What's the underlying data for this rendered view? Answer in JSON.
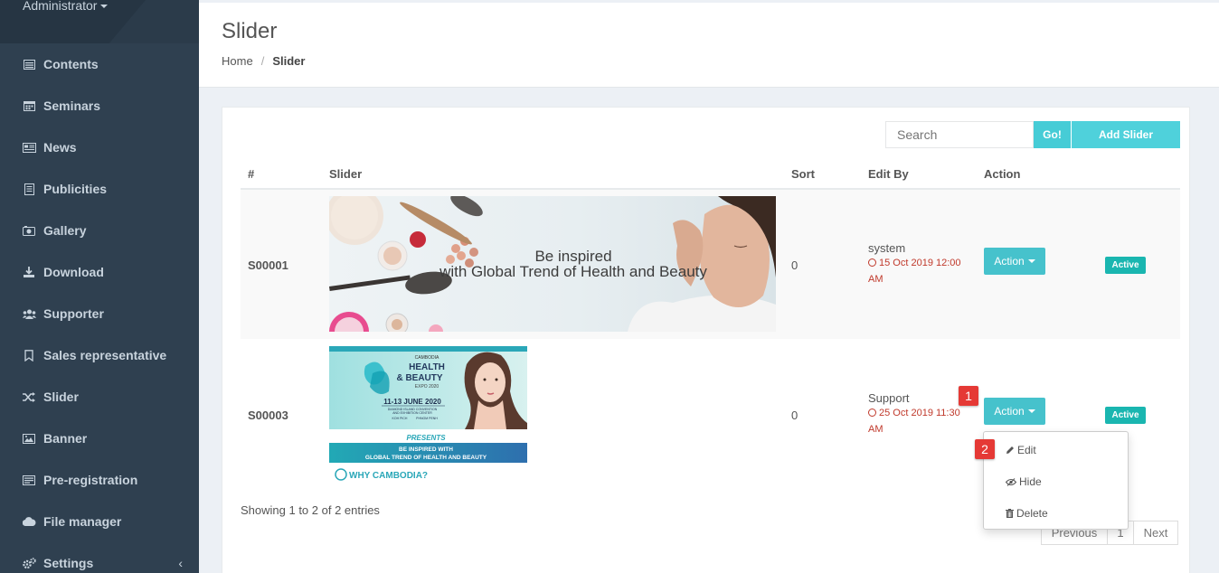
{
  "sidebar": {
    "user": "Administrator",
    "items": [
      {
        "label": "Contents",
        "icon": "list-icon"
      },
      {
        "label": "Seminars",
        "icon": "calendar-icon"
      },
      {
        "label": "News",
        "icon": "newspaper-icon"
      },
      {
        "label": "Publicities",
        "icon": "file-icon"
      },
      {
        "label": "Gallery",
        "icon": "camera-icon"
      },
      {
        "label": "Download",
        "icon": "download-icon"
      },
      {
        "label": "Supporter",
        "icon": "users-icon"
      },
      {
        "label": "Sales representative",
        "icon": "bookmark-icon"
      },
      {
        "label": "Slider",
        "icon": "shuffle-icon"
      },
      {
        "label": "Banner",
        "icon": "image-icon"
      },
      {
        "label": "Pre-registration",
        "icon": "register-icon"
      },
      {
        "label": "File manager",
        "icon": "cloud-icon"
      },
      {
        "label": "Settings",
        "icon": "cogs-icon"
      }
    ],
    "settings_arrow": "‹"
  },
  "header": {
    "title": "Slider",
    "breadcrumb": {
      "home": "Home",
      "separator": "/",
      "current": "Slider"
    }
  },
  "toolbar": {
    "search_placeholder": "Search",
    "go_label": "Go!",
    "add_label": "Add Slider"
  },
  "table": {
    "columns": [
      "#",
      "Slider",
      "Sort",
      "Edit By",
      "Action"
    ],
    "rows": [
      {
        "code": "S00001",
        "banner_text_1": "Be inspired",
        "banner_text_2": "with Global Trend of Health and Beauty",
        "sort": "0",
        "edited_by": "system",
        "date_1": "15 Oct 2019 12:00",
        "date_2": "AM",
        "action_label": "Action",
        "status": "Active"
      },
      {
        "code": "S00003",
        "banner_small": "CAMBODIA",
        "banner_title_1": "HEALTH",
        "banner_title_2": "& BEAUTY",
        "banner_expo": "EXPO 2020",
        "banner_date": "11-13 JUNE 2020",
        "banner_venue_1": "DIAMOND ISLAND CONVENTION",
        "banner_venue_2": "AND EXHIBITION CENTER",
        "banner_city_1": "KOH PICH",
        "banner_city_2": "PHNOM PENH",
        "banner_presents": "PRESENTS",
        "banner_line_1": "BE INSPIRED WITH",
        "banner_line_2": "GLOBAL TREND OF HEALTH AND BEAUTY",
        "banner_why": "WHY CAMBODIA?",
        "sort": "0",
        "edited_by": "Support",
        "date_1": "25 Oct 2019 11:30",
        "date_2": "AM",
        "action_label": "Action",
        "status": "Active"
      }
    ]
  },
  "dropdown": {
    "items": [
      {
        "label": "Edit",
        "icon": "pencil-icon"
      },
      {
        "label": "Hide",
        "icon": "eye-slash-icon"
      },
      {
        "label": "Delete",
        "icon": "trash-icon"
      }
    ]
  },
  "markers": [
    "1",
    "2"
  ],
  "footer": {
    "info": "Showing 1 to 2 of 2 entries",
    "previous": "Previous",
    "page": "1",
    "next": "Next"
  },
  "colors": {
    "sidebar_bg": "#2f4050",
    "accent": "#46c2cc",
    "active_badge": "#1ab6b0",
    "date_red": "#c0392b",
    "marker_red": "#e53935"
  }
}
